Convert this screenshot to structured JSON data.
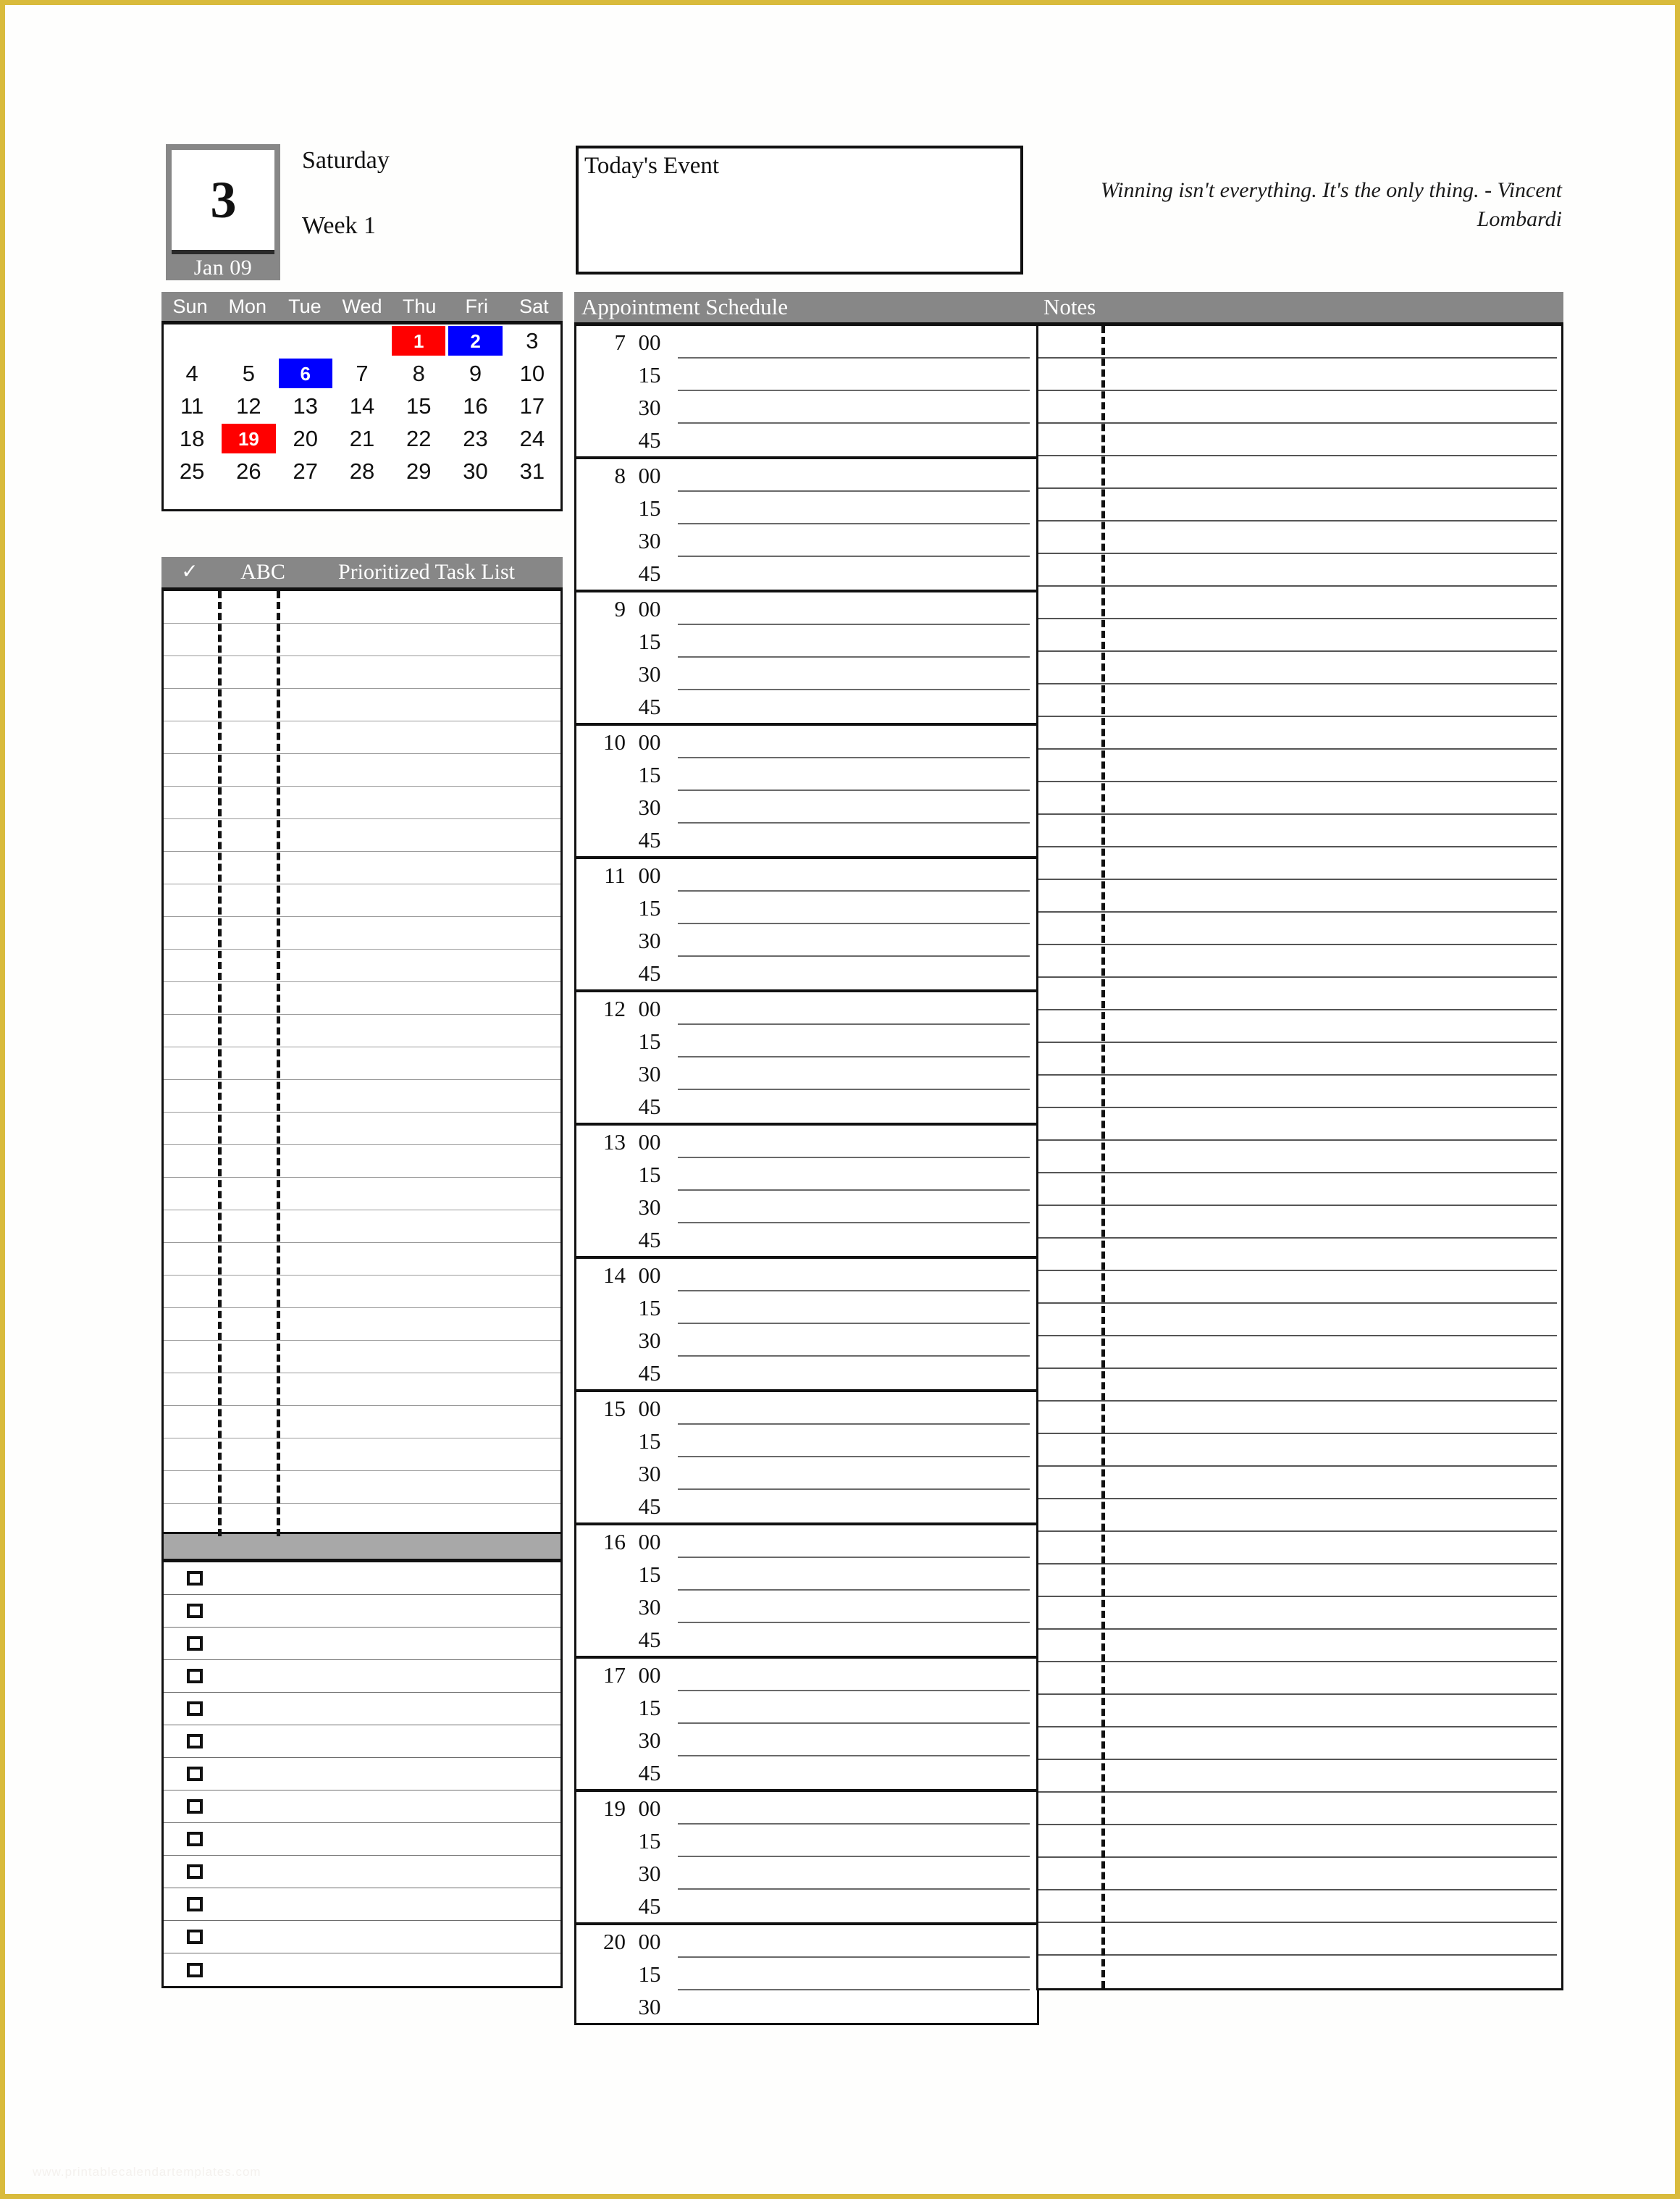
{
  "page": {
    "border_color": "#d9bb3c",
    "background": "#fefefd",
    "watermark": "www.printablecalendartemplates.com"
  },
  "header": {
    "date_number": "3",
    "date_month": "Jan 09",
    "weekday": "Saturday",
    "week": "Week 1",
    "todays_event_title": "Today's Event",
    "quote": "Winning isn't everything. It's the only thing. - Vincent Lombardi"
  },
  "mini_calendar": {
    "day_headers": [
      "Sun",
      "Mon",
      "Tue",
      "Wed",
      "Thu",
      "Fri",
      "Sat"
    ],
    "highlight_red": "#ff0000",
    "highlight_blue": "#0000ff",
    "weeks": [
      [
        {
          "num": "",
          "hl": ""
        },
        {
          "num": "",
          "hl": ""
        },
        {
          "num": "",
          "hl": ""
        },
        {
          "num": "",
          "hl": ""
        },
        {
          "num": "1",
          "hl": "red"
        },
        {
          "num": "2",
          "hl": "blue"
        },
        {
          "num": "3",
          "hl": ""
        }
      ],
      [
        {
          "num": "4",
          "hl": ""
        },
        {
          "num": "5",
          "hl": ""
        },
        {
          "num": "6",
          "hl": "blue"
        },
        {
          "num": "7",
          "hl": ""
        },
        {
          "num": "8",
          "hl": ""
        },
        {
          "num": "9",
          "hl": ""
        },
        {
          "num": "10",
          "hl": ""
        }
      ],
      [
        {
          "num": "11",
          "hl": ""
        },
        {
          "num": "12",
          "hl": ""
        },
        {
          "num": "13",
          "hl": ""
        },
        {
          "num": "14",
          "hl": ""
        },
        {
          "num": "15",
          "hl": ""
        },
        {
          "num": "16",
          "hl": ""
        },
        {
          "num": "17",
          "hl": ""
        }
      ],
      [
        {
          "num": "18",
          "hl": ""
        },
        {
          "num": "19",
          "hl": "red"
        },
        {
          "num": "20",
          "hl": ""
        },
        {
          "num": "21",
          "hl": ""
        },
        {
          "num": "22",
          "hl": ""
        },
        {
          "num": "23",
          "hl": ""
        },
        {
          "num": "24",
          "hl": ""
        }
      ],
      [
        {
          "num": "25",
          "hl": ""
        },
        {
          "num": "26",
          "hl": ""
        },
        {
          "num": "27",
          "hl": ""
        },
        {
          "num": "28",
          "hl": ""
        },
        {
          "num": "29",
          "hl": ""
        },
        {
          "num": "30",
          "hl": ""
        },
        {
          "num": "31",
          "hl": ""
        }
      ]
    ]
  },
  "task_list": {
    "header": {
      "check_icon": "check-icon",
      "check_label": "✓",
      "abc_label": "ABC",
      "title_label": "Prioritized Task List"
    },
    "row_count": 29,
    "rows": []
  },
  "checklist": {
    "header_label": "",
    "row_count": 13,
    "checkbox_icon": "checkbox-icon",
    "rows": []
  },
  "schedule": {
    "title": "Appointment Schedule",
    "minutes": [
      "00",
      "15",
      "30",
      "45"
    ],
    "hours": [
      {
        "hour": "7",
        "slots": [
          "00",
          "15",
          "30",
          "45"
        ]
      },
      {
        "hour": "8",
        "slots": [
          "00",
          "15",
          "30",
          "45"
        ]
      },
      {
        "hour": "9",
        "slots": [
          "00",
          "15",
          "30",
          "45"
        ]
      },
      {
        "hour": "10",
        "slots": [
          "00",
          "15",
          "30",
          "45"
        ]
      },
      {
        "hour": "11",
        "slots": [
          "00",
          "15",
          "30",
          "45"
        ]
      },
      {
        "hour": "12",
        "slots": [
          "00",
          "15",
          "30",
          "45"
        ]
      },
      {
        "hour": "13",
        "slots": [
          "00",
          "15",
          "30",
          "45"
        ]
      },
      {
        "hour": "14",
        "slots": [
          "00",
          "15",
          "30",
          "45"
        ]
      },
      {
        "hour": "15",
        "slots": [
          "00",
          "15",
          "30",
          "45"
        ]
      },
      {
        "hour": "16",
        "slots": [
          "00",
          "15",
          "30",
          "45"
        ]
      },
      {
        "hour": "17",
        "slots": [
          "00",
          "15",
          "30",
          "45"
        ]
      },
      {
        "hour": "19",
        "slots": [
          "00",
          "15",
          "30",
          "45"
        ]
      },
      {
        "hour": "20",
        "slots": [
          "00",
          "15",
          "30"
        ]
      }
    ]
  },
  "notes": {
    "title": "Notes",
    "row_count": 51,
    "rows": []
  }
}
